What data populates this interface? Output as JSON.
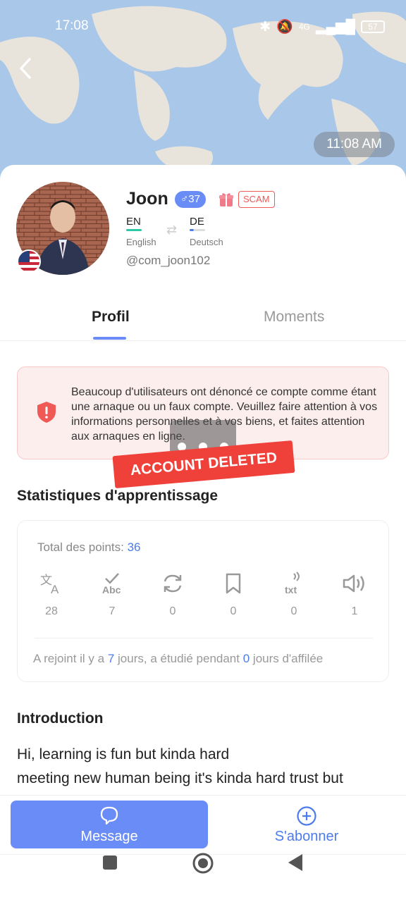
{
  "status_bar": {
    "time": "17:08",
    "battery": "57",
    "network": "4G"
  },
  "header": {
    "message_time": "11:08 AM"
  },
  "profile": {
    "name": "Joon",
    "gender_symbol": "♂",
    "age": "37",
    "badge": "SCAM",
    "handle": "@com_joon102",
    "native_language": {
      "code": "EN",
      "name": "English"
    },
    "learning_language": {
      "code": "DE",
      "name": "Deutsch"
    }
  },
  "tabs": [
    {
      "label": "Profil"
    },
    {
      "label": "Moments"
    }
  ],
  "warning": {
    "text": "Beaucoup d'utilisateurs ont dénoncé ce compte comme étant une arnaque ou un faux compte. Veuillez faire attention à vos informations personnelles et à vos biens, et faites attention aux arnaques en ligne.",
    "overlay_label": "ACCOUNT DELETED"
  },
  "stats": {
    "title": "Statistiques d'apprentissage",
    "total_label": "Total des points:",
    "total_value": "36",
    "items": [
      {
        "icon": "translate-icon",
        "value": "28"
      },
      {
        "icon": "spellcheck-icon",
        "value": "7"
      },
      {
        "icon": "refresh-icon",
        "value": "0"
      },
      {
        "icon": "bookmark-icon",
        "value": "0"
      },
      {
        "icon": "text-to-speech-icon",
        "value": "0"
      },
      {
        "icon": "speaker-icon",
        "value": "1"
      }
    ],
    "joined_prefix": "A rejoint il y a ",
    "joined_days": "7",
    "joined_mid": " jours, a étudié pendant ",
    "streak_days": "0",
    "joined_suffix": " jours d'affilée"
  },
  "introduction": {
    "title": "Introduction",
    "line1": "Hi, learning is fun but kinda hard",
    "line2": "meeting new human being it's kinda hard trust but"
  },
  "actions": {
    "message": "Message",
    "subscribe": "S'abonner"
  },
  "colors": {
    "accent": "#6a8cf6",
    "danger": "#ef5a56",
    "link": "#4b7bec"
  }
}
